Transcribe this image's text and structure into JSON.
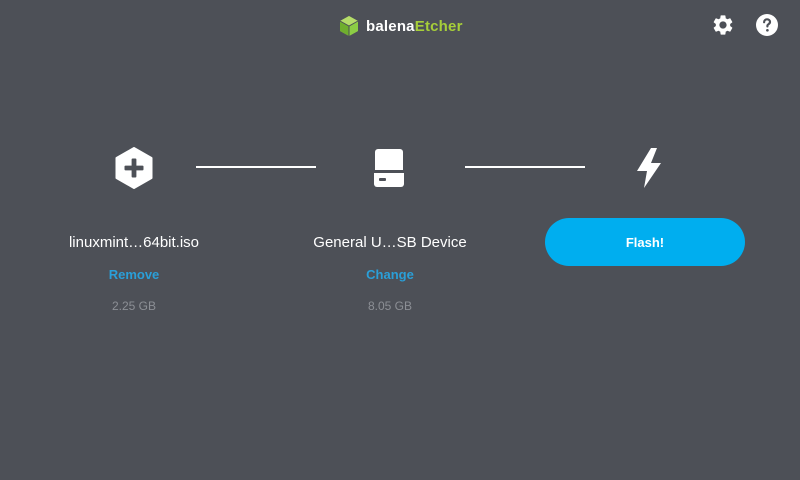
{
  "header": {
    "brand_balena": "balena",
    "brand_etcher": "Etcher",
    "brand_icon": "cube-logo",
    "settings_icon": "gear-icon",
    "help_icon": "question-circle-icon"
  },
  "steps": {
    "image": {
      "icon": "plus-hexagon-icon",
      "title": "linuxmint…64bit.iso",
      "action_label": "Remove",
      "size": "2.25 GB"
    },
    "drive": {
      "icon": "drive-icon",
      "title": "General U…SB Device",
      "action_label": "Change",
      "size": "8.05 GB"
    },
    "flash": {
      "icon": "lightning-icon",
      "button_label": "Flash!"
    }
  },
  "colors": {
    "background": "#4d5057",
    "accent": "#00aeef",
    "link": "#2a9fd8",
    "brand_green": "#a6ce39",
    "muted_text": "#8c8f95"
  }
}
